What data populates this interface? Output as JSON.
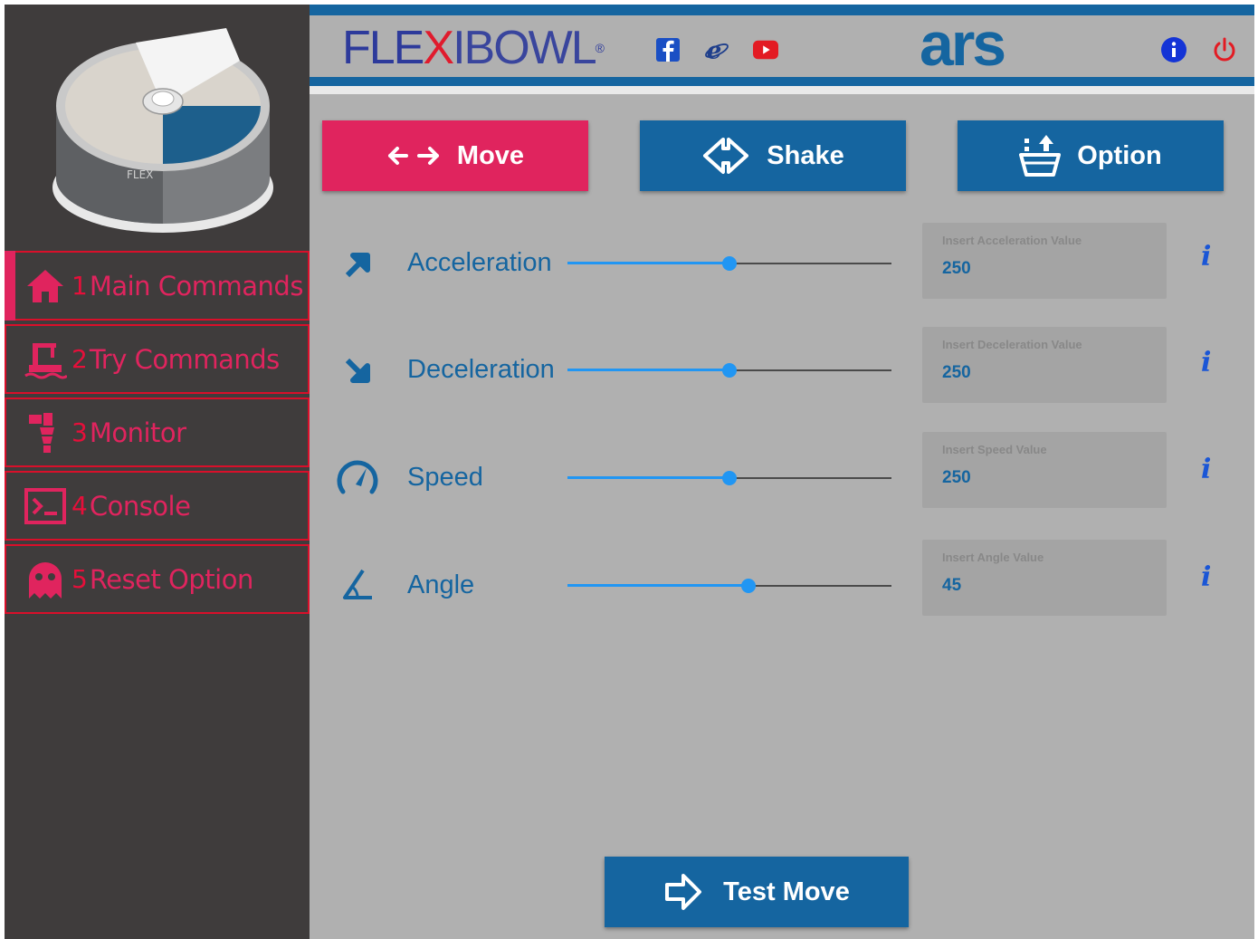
{
  "brand": {
    "part1": "FLE",
    "x": "X",
    "part2": "IBOWL",
    "reg": "®",
    "company": "ars"
  },
  "social": [
    {
      "name": "facebook-icon"
    },
    {
      "name": "internet-explorer-icon"
    },
    {
      "name": "youtube-icon"
    }
  ],
  "sidebar": {
    "items": [
      {
        "num": "1",
        "label": "Main Commands",
        "icon": "home-icon",
        "active": true
      },
      {
        "num": "2",
        "label": "Try Commands",
        "icon": "try-commands-icon"
      },
      {
        "num": "3",
        "label": "Monitor",
        "icon": "monitor-icon"
      },
      {
        "num": "4",
        "label": "Console",
        "icon": "console-icon"
      },
      {
        "num": "5",
        "label": "Reset Option",
        "icon": "ghost-icon"
      }
    ]
  },
  "tabs": [
    {
      "label": "Move",
      "active": true
    },
    {
      "label": "Shake"
    },
    {
      "label": "Option"
    }
  ],
  "params": [
    {
      "label": "Acceleration",
      "placeholder": "Insert Acceleration Value",
      "value": "250",
      "slider_fraction": 0.5
    },
    {
      "label": "Deceleration",
      "placeholder": "Insert Deceleration Value",
      "value": "250",
      "slider_fraction": 0.5
    },
    {
      "label": "Speed",
      "placeholder": "Insert Speed Value",
      "value": "250",
      "slider_fraction": 0.5
    },
    {
      "label": "Angle",
      "placeholder": "Insert Angle Value",
      "value": "45",
      "slider_fraction": 0.56
    }
  ],
  "info_label": "i",
  "test_move_label": "Test Move",
  "colors": {
    "accent_blue": "#1565a0",
    "accent_pink": "#e0245e",
    "sidebar_bg": "#3f3c3c",
    "main_bg": "#b0b0b0",
    "slider_blue": "#2196f3"
  }
}
